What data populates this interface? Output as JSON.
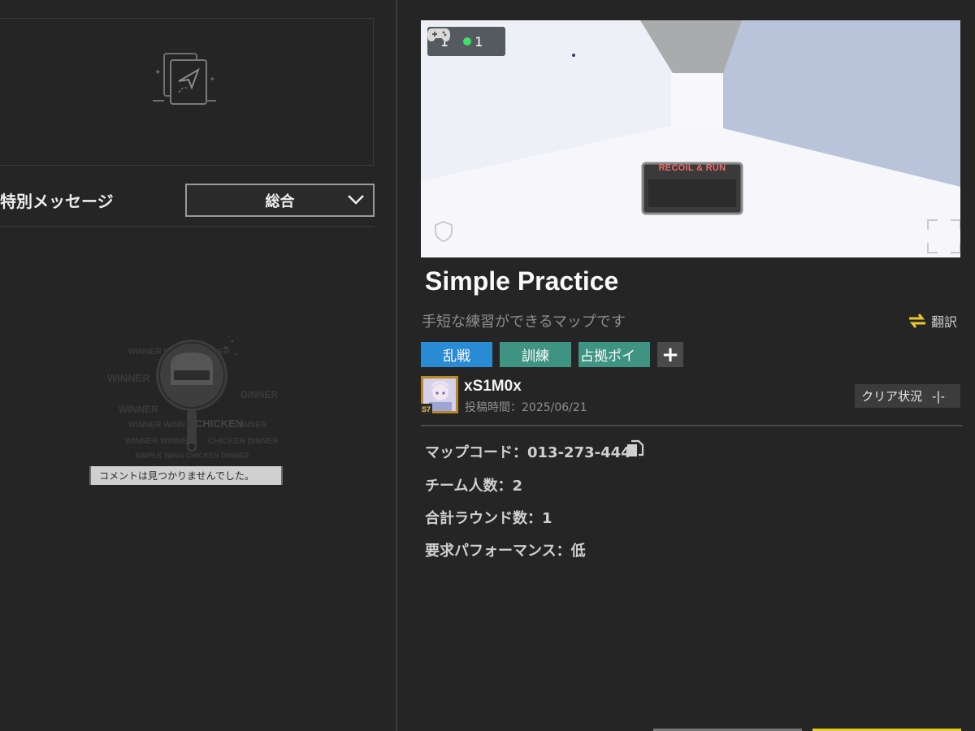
{
  "left_panel": {
    "special_message_label": "特別メッセージ",
    "filter": {
      "selected": "総合"
    },
    "empty_comment_text": "コメントは見つかりませんでした。",
    "illustration_words": [
      "WINNER",
      "WINNER",
      "CHICKEN",
      "DINNER"
    ]
  },
  "map": {
    "preview": {
      "controller_count": "1",
      "online_count": "1",
      "sign_text": "RECOIL & RUN"
    },
    "title": "Simple Practice",
    "description": "手短な練習ができるマップです",
    "translate_label": "翻訳",
    "tags": [
      "乱戦",
      "訓練",
      "占拠ポイ"
    ],
    "author": {
      "name": "xS1M0x",
      "season_badge": "S7",
      "post_time": "投稿時間：2025/06/21"
    },
    "clear_status": {
      "label": "クリア状況",
      "value": "-|-"
    },
    "info": {
      "map_code": "マップコード：013-273-444",
      "team_size": "チーム人数：2",
      "total_rounds": "合計ラウンド数：1",
      "performance": "要求パフォーマンス：低"
    }
  },
  "colors": {
    "background": "#252525",
    "tag_blue": "#2a8bd5",
    "tag_green": "#3f9383",
    "accent_yellow": "#e8cb2a",
    "online_green": "#3ee06a"
  }
}
